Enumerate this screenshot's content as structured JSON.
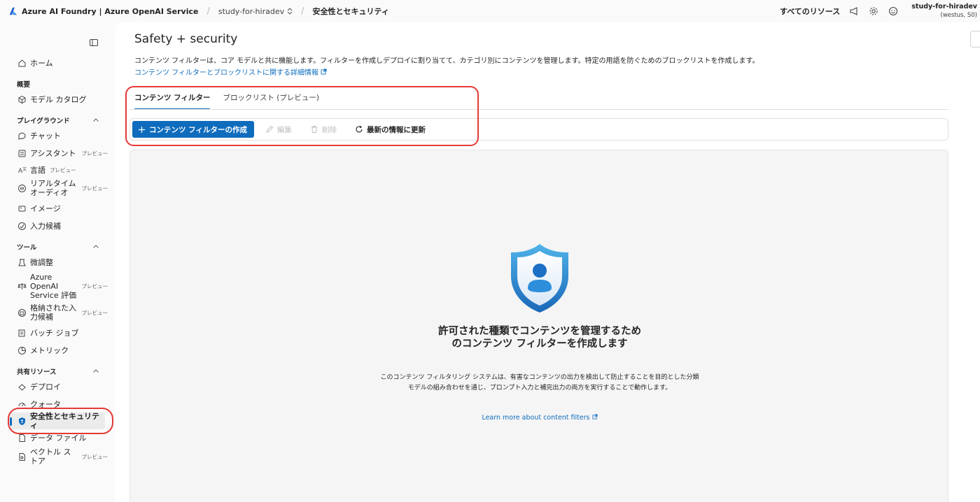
{
  "topbar": {
    "brand": "Azure AI Foundry | Azure OpenAI Service",
    "project": "study-for-hiradev",
    "current": "安全性とセキュリティ",
    "all_resources": "すべてのリソース",
    "account_name": "study-for-hiradev",
    "account_sub": "(westus, S0)"
  },
  "sidebar": {
    "home": "ホーム",
    "section_overview": "概要",
    "model_catalog": "モデル カタログ",
    "section_playground": "プレイグラウンド",
    "chat": "チャット",
    "assistant": "アシスタント",
    "language": "言語",
    "realtime_audio_1": "リアルタイム",
    "realtime_audio_2": "オーディオ",
    "image": "イメージ",
    "completion": "入力候補",
    "section_tools": "ツール",
    "finetune": "微調整",
    "eval_1": "Azure",
    "eval_2": "OpenAI",
    "eval_3": "Service 評価",
    "stored_1": "格納された入",
    "stored_2": "力候補",
    "batch": "バッチ ジョブ",
    "metrics": "メトリック",
    "section_shared": "共有リソース",
    "deploy": "デプロイ",
    "quota": "クォータ",
    "safety": "安全性とセキュリティ",
    "data_files": "データ ファイル",
    "vector_1": "ベクトル ス",
    "vector_2": "トア",
    "preview_badge": "プレビュー"
  },
  "main": {
    "title": "Safety + security",
    "description": "コンテンツ フィルターは、コア モデルと共に機能します。フィルターを作成しデプロイに割り当てて、カテゴリ別にコンテンツを管理します。特定の用語を防ぐためのブロックリストを作成します。",
    "learn_link": "コンテンツ フィルターとブロックリストに関する詳細情報",
    "tab_filters": "コンテンツ フィルター",
    "tab_blocklist": "ブロックリスト (プレビュー)",
    "btn_create": "コンテンツ フィルターの作成",
    "btn_edit": "編集",
    "btn_delete": "削除",
    "btn_refresh": "最新の情報に更新",
    "empty_title": "許可された種類でコンテンツを管理するためのコンテンツ フィルターを作成します",
    "empty_desc": "このコンテンツ フィルタリング システムは、有害なコンテンツの出力を検出して防止することを目的とした分類モデルの組み合わせを通じ、プロンプト入力と補完出力の両方を実行することで動作します。",
    "empty_link": "Learn more about content filters"
  },
  "colors": {
    "accent": "#0f6cbd",
    "annotation": "#e53935"
  }
}
